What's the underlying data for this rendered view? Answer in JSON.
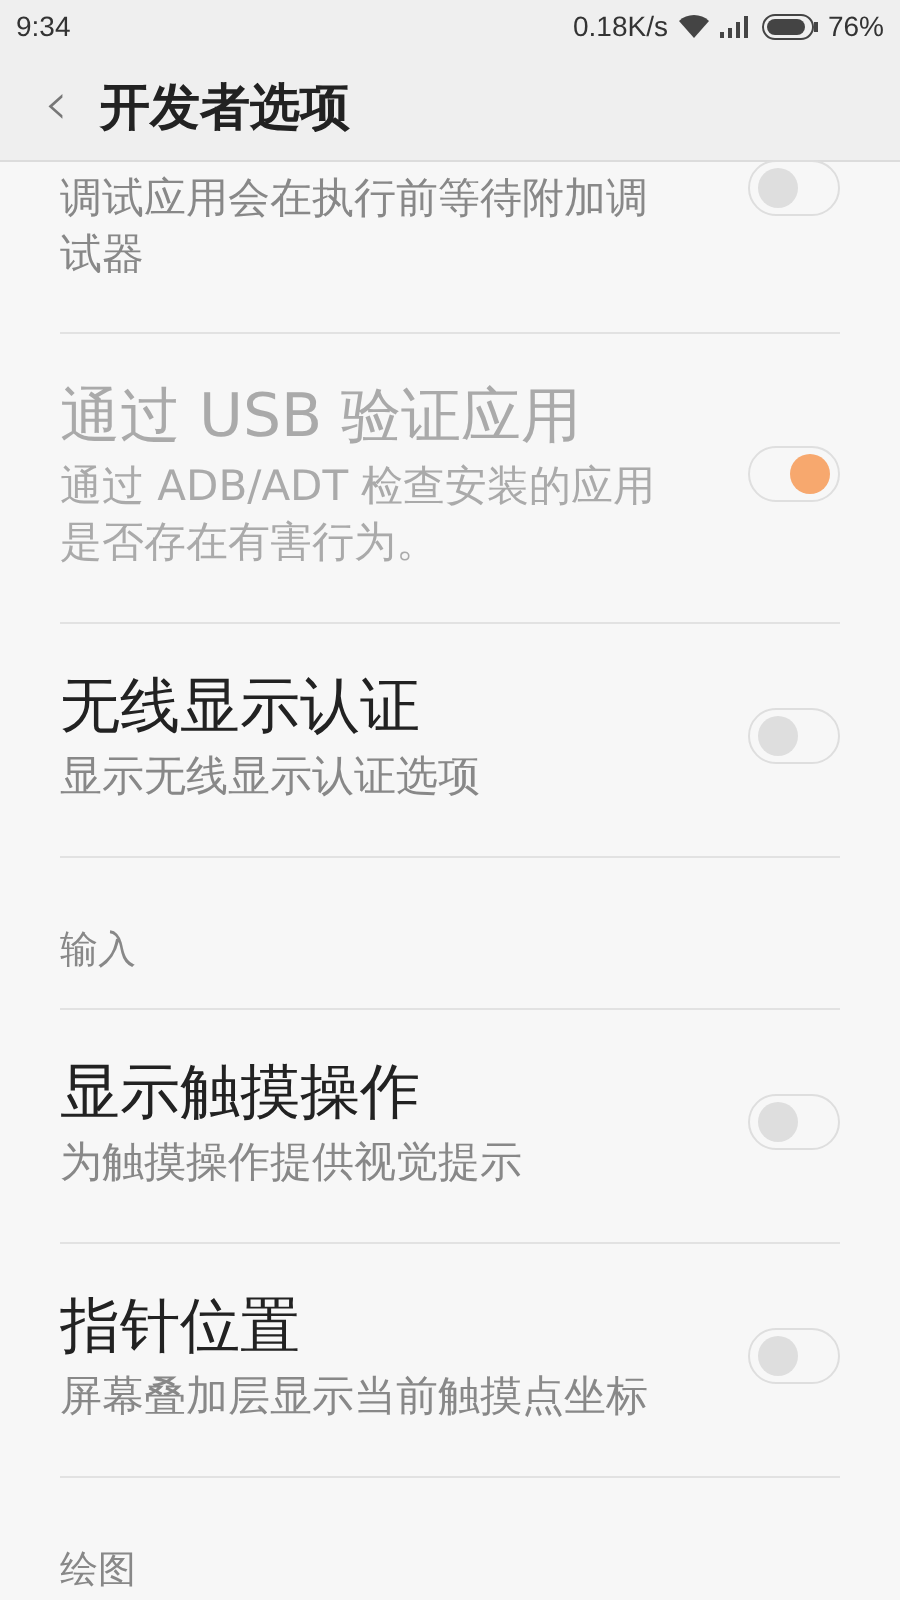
{
  "status_bar": {
    "time": "9:34",
    "network_speed": "0.18K/s",
    "battery": "76%"
  },
  "header": {
    "back": "‹",
    "title": "开发者选项"
  },
  "items": [
    {
      "kind": "switch",
      "summary": "调试应用会在执行前等待附加调试器",
      "on": false,
      "disabled": false
    },
    {
      "kind": "switch",
      "title": "通过 USB 验证应用",
      "summary": "通过 ADB/ADT 检查安装的应用是否存在有害行为。",
      "on": true,
      "disabled": true
    },
    {
      "kind": "switch",
      "title": "无线显示认证",
      "summary": "显示无线显示认证选项",
      "on": false,
      "disabled": false
    },
    {
      "kind": "category",
      "title": "输入"
    },
    {
      "kind": "switch",
      "title": "显示触摸操作",
      "summary": "为触摸操作提供视觉提示",
      "on": false,
      "disabled": false
    },
    {
      "kind": "switch",
      "title": "指针位置",
      "summary": "屏幕叠加层显示当前触摸点坐标",
      "on": false,
      "disabled": false
    },
    {
      "kind": "category",
      "title": "绘图"
    }
  ]
}
